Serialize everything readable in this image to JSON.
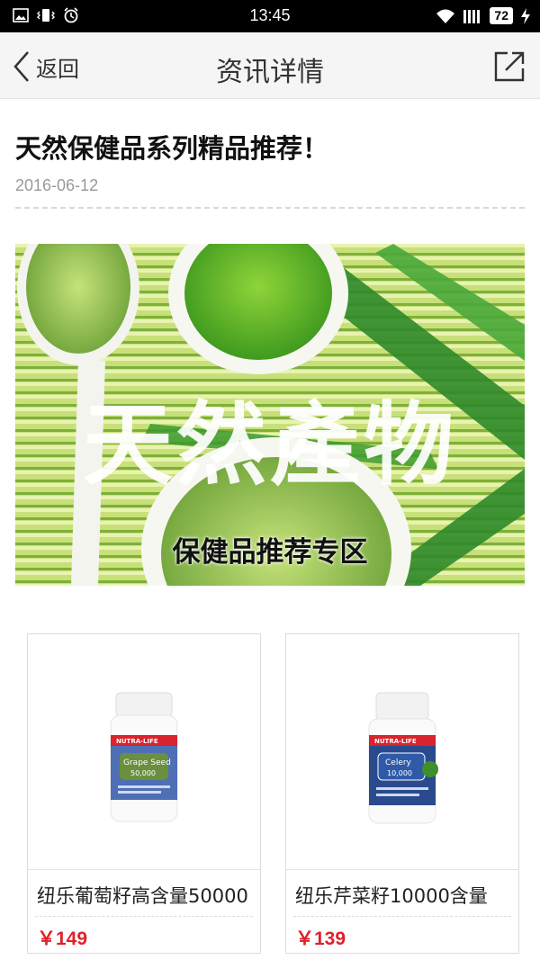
{
  "status_bar": {
    "time": "13:45",
    "battery": "72",
    "left_icons": [
      "image-icon",
      "vibrate-icon",
      "alarm-icon"
    ],
    "right_icons": [
      "wifi-icon",
      "signal-icon",
      "battery-icon",
      "charging-icon"
    ]
  },
  "nav": {
    "back_label": "返回",
    "title": "资讯详情",
    "share_icon": "share-icon"
  },
  "article": {
    "title": "天然保健品系列精品推荐！",
    "date": "2016-06-12"
  },
  "banner": {
    "main_text": "天然產物",
    "sub_text": "保健品推荐专区"
  },
  "products": [
    {
      "name": "纽乐葡萄籽高含量50000",
      "price": "￥149",
      "label_brand": "NUTRA-LIFE",
      "label_title": "Grape Seed",
      "label_value": "50,000",
      "label_color": "#6a8f3e"
    },
    {
      "name": "纽乐芹菜籽10000含量",
      "price": "￥139",
      "label_brand": "NUTRA-LIFE",
      "label_title": "Celery",
      "label_value": "10,000",
      "label_color": "#2f5aa8"
    }
  ],
  "colors": {
    "price": "#e0202a",
    "nav_bg": "#f5f5f5",
    "brand_red": "#d9232d"
  }
}
